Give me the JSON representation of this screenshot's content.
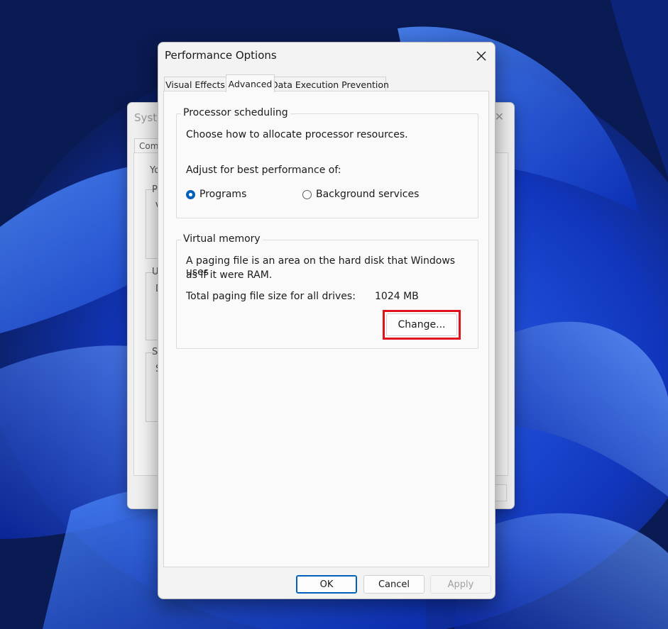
{
  "background_window": {
    "title": "Syste",
    "tab": "Com",
    "fragments": [
      "Yo",
      "P",
      "V",
      "U",
      "D",
      "S",
      "S"
    ]
  },
  "dialog": {
    "title": "Performance Options",
    "close_icon": "close-icon",
    "tabs": [
      {
        "label": "Visual Effects",
        "active": false
      },
      {
        "label": "Advanced",
        "active": true
      },
      {
        "label": "Data Execution Prevention",
        "active": false
      }
    ],
    "processor_scheduling": {
      "legend": "Processor scheduling",
      "description": "Choose how to allocate processor resources.",
      "adjust_label": "Adjust for best performance of:",
      "options": [
        {
          "label": "Programs",
          "selected": true
        },
        {
          "label": "Background services",
          "selected": false
        }
      ]
    },
    "virtual_memory": {
      "legend": "Virtual memory",
      "description_line1": "A paging file is an area on the hard disk that Windows uses",
      "description_line2": "as if it were RAM.",
      "total_label": "Total paging file size for all drives:",
      "total_value": "1024 MB",
      "change_button": "Change..."
    },
    "buttons": {
      "ok": "OK",
      "cancel": "Cancel",
      "apply": "Apply"
    }
  },
  "colors": {
    "accent": "#005fb8",
    "highlight": "#e0121b"
  }
}
